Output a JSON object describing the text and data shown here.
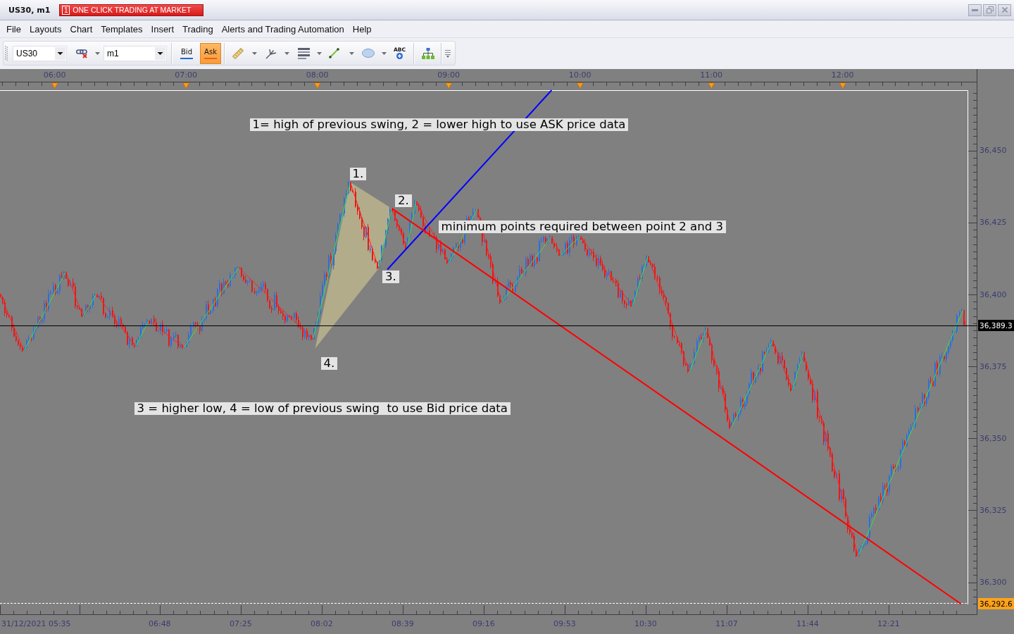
{
  "window": {
    "title": "US30, m1",
    "one_click_button": {
      "badge": "1",
      "label": "ONE CLICK TRADING AT MARKET"
    }
  },
  "menu": [
    "File",
    "Layouts",
    "Chart",
    "Templates",
    "Insert",
    "Trading",
    "Alerts and Trading Automation",
    "Help"
  ],
  "toolbar": {
    "symbol": {
      "value": "US30"
    },
    "timeframe": {
      "value": "m1"
    },
    "price_sources": [
      {
        "label": "Bid",
        "selected": false,
        "color": "#1c6ad6"
      },
      {
        "label": "Ask",
        "selected": true,
        "color": "#e8601c"
      }
    ],
    "text_tool": {
      "label": "ABC"
    }
  },
  "chart": {
    "hour_markers": [
      "06:00",
      "07:00",
      "08:00",
      "09:00",
      "10:00",
      "11:00",
      "12:00"
    ],
    "chart_data": {
      "type": "line",
      "xlim": [
        335,
        777
      ],
      "ylim": [
        36292.3,
        36471.0
      ],
      "xticks": [
        {
          "value": 335,
          "label": "31/12/2021 05:35"
        },
        {
          "value": 408,
          "label": "06:48"
        },
        {
          "value": 445,
          "label": "07:25"
        },
        {
          "value": 482,
          "label": "08:02"
        },
        {
          "value": 519,
          "label": "08:39"
        },
        {
          "value": 556,
          "label": "09:16"
        },
        {
          "value": 593,
          "label": "09:53"
        },
        {
          "value": 630,
          "label": "10:30"
        },
        {
          "value": 667,
          "label": "11:07"
        },
        {
          "value": 704,
          "label": "11:44"
        },
        {
          "value": 741,
          "label": "12:21"
        }
      ],
      "yticks": [
        {
          "value": 36300,
          "label": "36,300"
        },
        {
          "value": 36325,
          "label": "36,325"
        },
        {
          "value": 36350,
          "label": "36,350"
        },
        {
          "value": 36375,
          "label": "36,375"
        },
        {
          "value": 36400,
          "label": "36,400"
        },
        {
          "value": 36425,
          "label": "36,425"
        },
        {
          "value": 36450,
          "label": "36,450"
        }
      ],
      "x": [
        335,
        346,
        365,
        373,
        379,
        397,
        403,
        419,
        444,
        478,
        495,
        508,
        514,
        521,
        525,
        540,
        553,
        564,
        587,
        591,
        600,
        624,
        631,
        650,
        658,
        669,
        688,
        697,
        702,
        727,
        775,
        776
      ],
      "series": [
        {
          "values": [
            36400.1,
            36380.5,
            36407.9,
            36392.3,
            36400.1,
            36382.0,
            36391.0,
            36381.5,
            36409.4,
            36384.4,
            36439.0,
            36409.1,
            36429.9,
            36415.8,
            36432.4,
            36410.9,
            36429.7,
            36397.2,
            36420.2,
            36413.6,
            36420.2,
            36395.9,
            36413.3,
            36373.2,
            36388.4,
            36353.6,
            36384.0,
            36366.6,
            36380.0,
            36309.1,
            36394.7,
            36389.3
          ]
        }
      ],
      "ref_lines": [
        {
          "axis": "y",
          "value": 36389.3,
          "label": "36,389.3",
          "color": "#000000"
        }
      ],
      "annotations": [
        "1= high of previous swing, 2 = lower high to use ASK price data",
        {
          "text": "1.",
          "x": 498.6,
          "y": 36441.9
        },
        {
          "text": "2.",
          "x": 519.3,
          "y": 36432.7
        },
        "minimum points required between point 2 and 3",
        {
          "text": "3.",
          "x": 513.5,
          "y": 36406.1
        },
        {
          "text": "4.",
          "x": 485.4,
          "y": 36376.0
        },
        "3 = higher low, 4 = low of previous swing  to use Bid price data"
      ]
    },
    "drawings": [
      {
        "kind": "pattern",
        "color": "#b2ac8a"
      },
      {
        "kind": "trend_line",
        "color": "#0000ff"
      },
      {
        "kind": "trend_line",
        "color": "#ff0000"
      },
      {
        "kind": "price_marker",
        "color": "#ffa31a",
        "label": "36,292.6"
      }
    ]
  }
}
